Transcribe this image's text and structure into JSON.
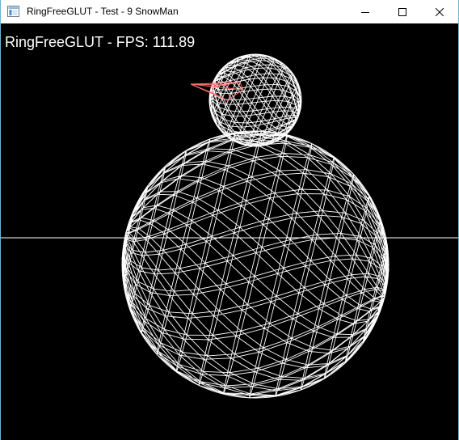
{
  "window": {
    "title": "RingFreeGLUT - Test - 9 SnowMan",
    "icon": "window-app-icon"
  },
  "controls": {
    "minimize_icon": "minimize-icon",
    "maximize_icon": "maximize-icon",
    "close_icon": "close-icon"
  },
  "overlay": {
    "fps_text": "RingFreeGLUT - FPS: 111.89"
  },
  "scene": {
    "background": "#000000",
    "wire_color": "#ffffff",
    "nose_color": "#ff6f6f",
    "objects": [
      "body-sphere",
      "head-sphere",
      "nose-cone",
      "ground-line"
    ]
  }
}
